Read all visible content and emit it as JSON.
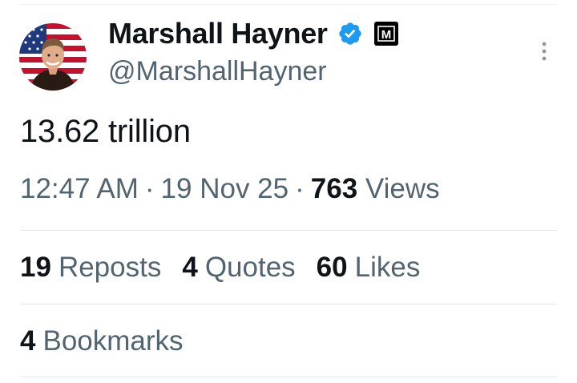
{
  "author": {
    "display_name": "Marshall Hayner",
    "handle": "@MarshallHayner",
    "avatar_icon": "user-avatar-flag-background",
    "verified_icon": "verified-badge-icon",
    "affiliate_badge_icon": "m-brand-badge-icon",
    "affiliate_badge_letter": "M"
  },
  "tweet": {
    "text": "13.62 trillion",
    "time": "12:47 AM",
    "date": "19 Nov 25",
    "views_count": "763",
    "views_label": "Views"
  },
  "stats": {
    "reposts_count": "19",
    "reposts_label": "Reposts",
    "quotes_count": "4",
    "quotes_label": "Quotes",
    "likes_count": "60",
    "likes_label": "Likes",
    "bookmarks_count": "4",
    "bookmarks_label": "Bookmarks"
  },
  "colors": {
    "text_primary": "#0f1419",
    "text_secondary": "#536471",
    "verified_blue": "#1d9bf0",
    "divider": "#e1e6ea"
  }
}
